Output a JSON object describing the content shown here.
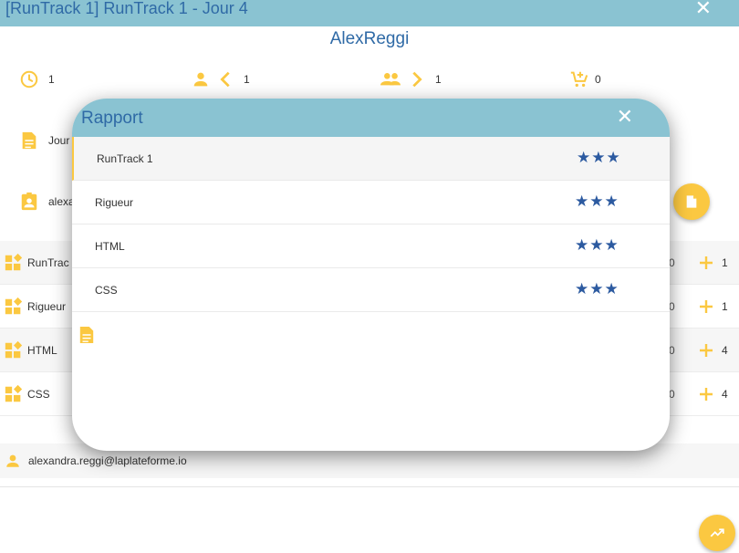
{
  "window": {
    "title": "[RunTrack 1] RunTrack 1 - Jour 4",
    "close_label": "✕"
  },
  "profile": {
    "username": "AlexReggi",
    "stats": [
      {
        "icon": "clock-icon",
        "value": "1"
      },
      {
        "icon": "person-chevron-left-icon",
        "value": "1"
      },
      {
        "icon": "group-chevron-right-icon",
        "value": "1"
      },
      {
        "icon": "cart-add-icon",
        "value": "0"
      }
    ],
    "job_label": "Jour",
    "user_label": "alexa"
  },
  "skills": [
    {
      "name": "RunTrac",
      "right_value": "0",
      "count": "1"
    },
    {
      "name": "Rigueur",
      "right_value": "0",
      "count": "1"
    },
    {
      "name": "HTML",
      "right_value": "0",
      "count": "4"
    },
    {
      "name": "CSS",
      "right_value": "0",
      "count": "4"
    }
  ],
  "footer": {
    "email": "alexandra.reggi@laplateforme.io"
  },
  "modal": {
    "title": "Rapport",
    "close_label": "✕",
    "rows": [
      {
        "name": "RunTrack 1",
        "stars": "★★★"
      },
      {
        "name": "Rigueur",
        "stars": "★★★"
      },
      {
        "name": "HTML",
        "stars": "★★★"
      },
      {
        "name": "CSS",
        "stars": "★★★"
      }
    ]
  },
  "colors": {
    "header": "#8ac3d2",
    "title_text": "#2f6aa6",
    "accent": "#fbc841",
    "stars": "#2c5aa0"
  }
}
